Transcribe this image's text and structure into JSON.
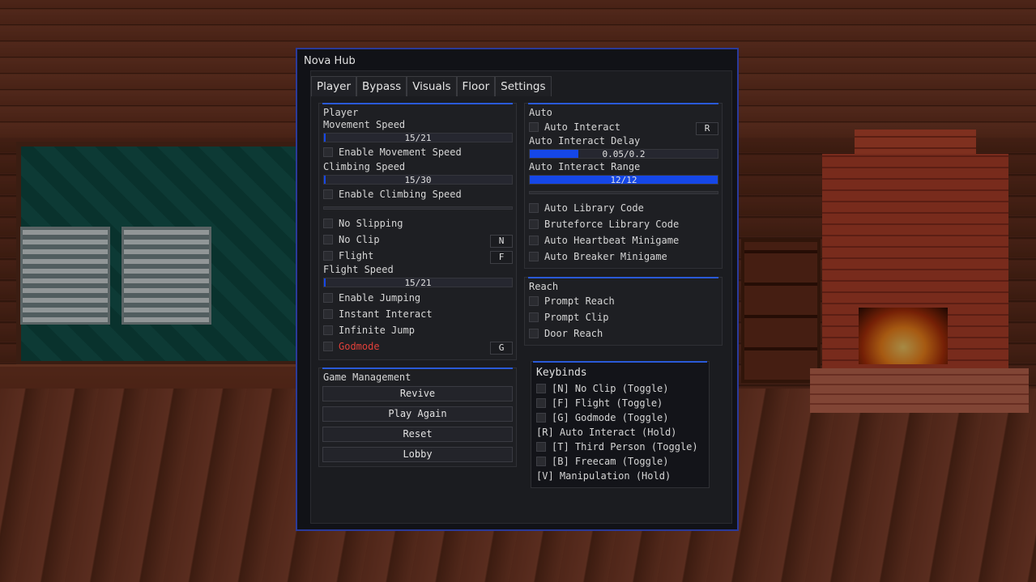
{
  "window": {
    "title": "Nova Hub"
  },
  "tabs": [
    "Player",
    "Bypass",
    "Visuals",
    "Floor",
    "Settings"
  ],
  "player": {
    "title": "Player",
    "movement_speed": {
      "label": "Movement Speed",
      "value": 15,
      "max": 21,
      "text": "15/21"
    },
    "enable_movement_speed": "Enable Movement Speed",
    "climbing_speed": {
      "label": "Climbing Speed",
      "value": 15,
      "max": 30,
      "text": "15/30"
    },
    "enable_climbing_speed": "Enable Climbing Speed",
    "no_slipping": "No Slipping",
    "no_clip": "No Clip",
    "no_clip_key": "N",
    "flight": "Flight",
    "flight_key": "F",
    "flight_speed": {
      "label": "Flight Speed",
      "value": 15,
      "max": 21,
      "text": "15/21"
    },
    "enable_jumping": "Enable Jumping",
    "instant_interact": "Instant Interact",
    "infinite_jump": "Infinite Jump",
    "godmode": "Godmode",
    "godmode_key": "G",
    "godmode_color": "#e2403a"
  },
  "game_management": {
    "title": "Game Management",
    "buttons": [
      "Revive",
      "Play Again",
      "Reset",
      "Lobby"
    ]
  },
  "auto": {
    "title": "Auto",
    "auto_interact": "Auto Interact",
    "auto_interact_key": "R",
    "delay": {
      "label": "Auto Interact Delay",
      "value": 0.05,
      "max": 0.2,
      "text": "0.05/0.2"
    },
    "range": {
      "label": "Auto Interact Range",
      "value": 12,
      "max": 12,
      "text": "12/12"
    },
    "auto_library_code": "Auto Library Code",
    "bruteforce_library_code": "Bruteforce Library Code",
    "auto_heartbeat": "Auto Heartbeat Minigame",
    "auto_breaker": "Auto Breaker Minigame"
  },
  "reach": {
    "title": "Reach",
    "prompt_reach": "Prompt Reach",
    "prompt_clip": "Prompt Clip",
    "door_reach": "Door Reach"
  },
  "keybinds": {
    "title": "Keybinds",
    "items": [
      {
        "text": "[N] No Clip (Toggle)",
        "checkbox": true
      },
      {
        "text": "[F] Flight (Toggle)",
        "checkbox": true
      },
      {
        "text": "[G] Godmode (Toggle)",
        "checkbox": true
      },
      {
        "text": "[R] Auto Interact (Hold)",
        "checkbox": false
      },
      {
        "text": "[T] Third Person (Toggle)",
        "checkbox": true
      },
      {
        "text": "[B] Freecam (Toggle)",
        "checkbox": true
      },
      {
        "text": "[V]  Manipulation (Hold)",
        "checkbox": false
      }
    ]
  },
  "colors": {
    "accent": "#1547e8",
    "window_border": "#2a3a9a"
  }
}
